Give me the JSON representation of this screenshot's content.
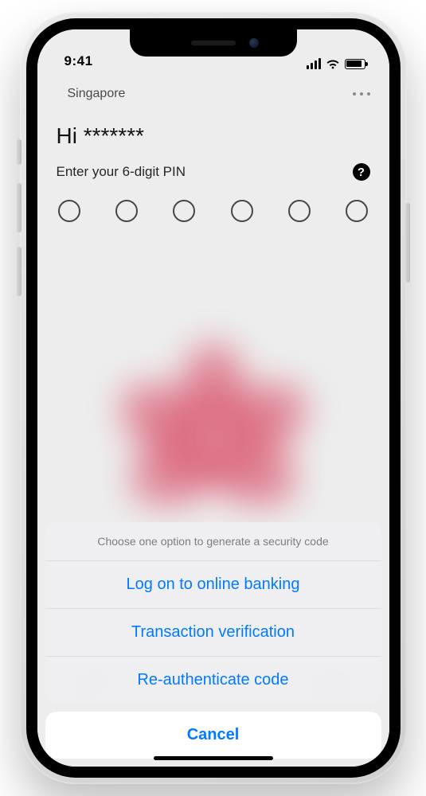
{
  "status": {
    "time": "9:41"
  },
  "header": {
    "location": "Singapore"
  },
  "login": {
    "greeting": "Hi *******",
    "pin_prompt": "Enter your 6-digit PIN",
    "help_glyph": "?",
    "pin_length": 6
  },
  "action_sheet": {
    "title": "Choose one option to generate a security code",
    "options": [
      "Log on to online banking",
      "Transaction verification",
      "Re-authenticate code"
    ],
    "cancel": "Cancel"
  },
  "colors": {
    "ios_blue": "#007aff"
  }
}
